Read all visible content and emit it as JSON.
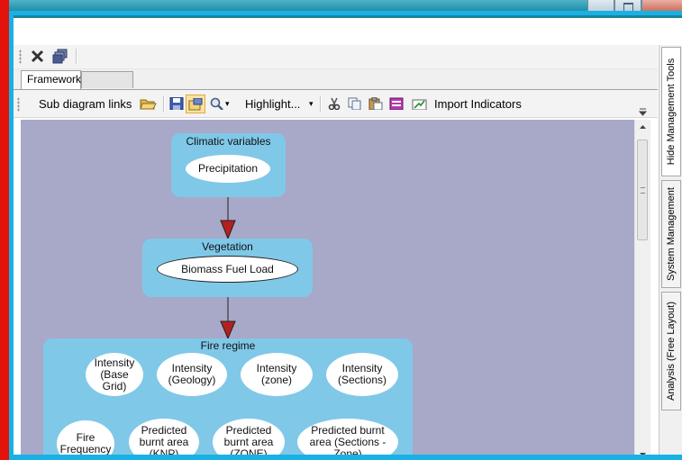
{
  "toolbar_top": {
    "close_icon": "close-x-icon",
    "window_icon": "window-cascade-icon"
  },
  "tabs": [
    {
      "label": "Framework",
      "active": true
    },
    {
      "label": "",
      "active": false
    }
  ],
  "diagram_toolbar": {
    "sub_diagram_links": "Sub diagram links",
    "highlight": "Highlight...",
    "highlight_arrow": "▾",
    "zoom_arrow": "▾",
    "import_indicators": "Import Indicators"
  },
  "side_tabs": [
    {
      "label": "Hide Management Tools"
    },
    {
      "label": "System Management"
    },
    {
      "label": "Analysis (Free Layout)"
    }
  ],
  "diagram": {
    "climatic": {
      "title": "Climatic variables",
      "node": "Precipitation"
    },
    "vegetation": {
      "title": "Vegetation",
      "node": "Biomass Fuel Load"
    },
    "fire_regime": {
      "title": "Fire regime",
      "n1": "Intensity\n(Base\nGrid)",
      "n2": "Intensity\n(Geology)",
      "n3": "Intensity\n(zone)",
      "n4": "Intensity\n(Sections)",
      "n5": "Fire\nFrequency",
      "n6": "Predicted\nburnt area\n(KNP)",
      "n7": "Predicted\nburnt area\n(ZONE)",
      "n8": "Predicted burnt\narea (Sections -\nZone)"
    }
  },
  "colors": {
    "canvas": "#a8a8c8",
    "group": "#80c8e8",
    "arrow": "#b42020",
    "frame_red": "#e3120b",
    "frame_cyan": "#19b1e4"
  }
}
